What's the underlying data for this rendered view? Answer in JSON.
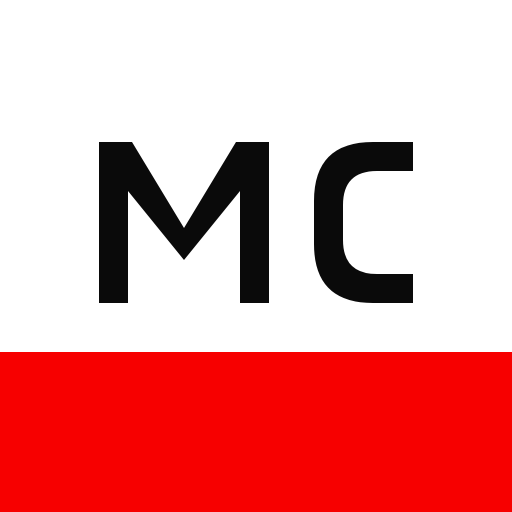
{
  "logo": {
    "text": "MC",
    "text_color": "#0a0a0a",
    "background_color": "#ffffff",
    "band_color": "#f70000"
  }
}
